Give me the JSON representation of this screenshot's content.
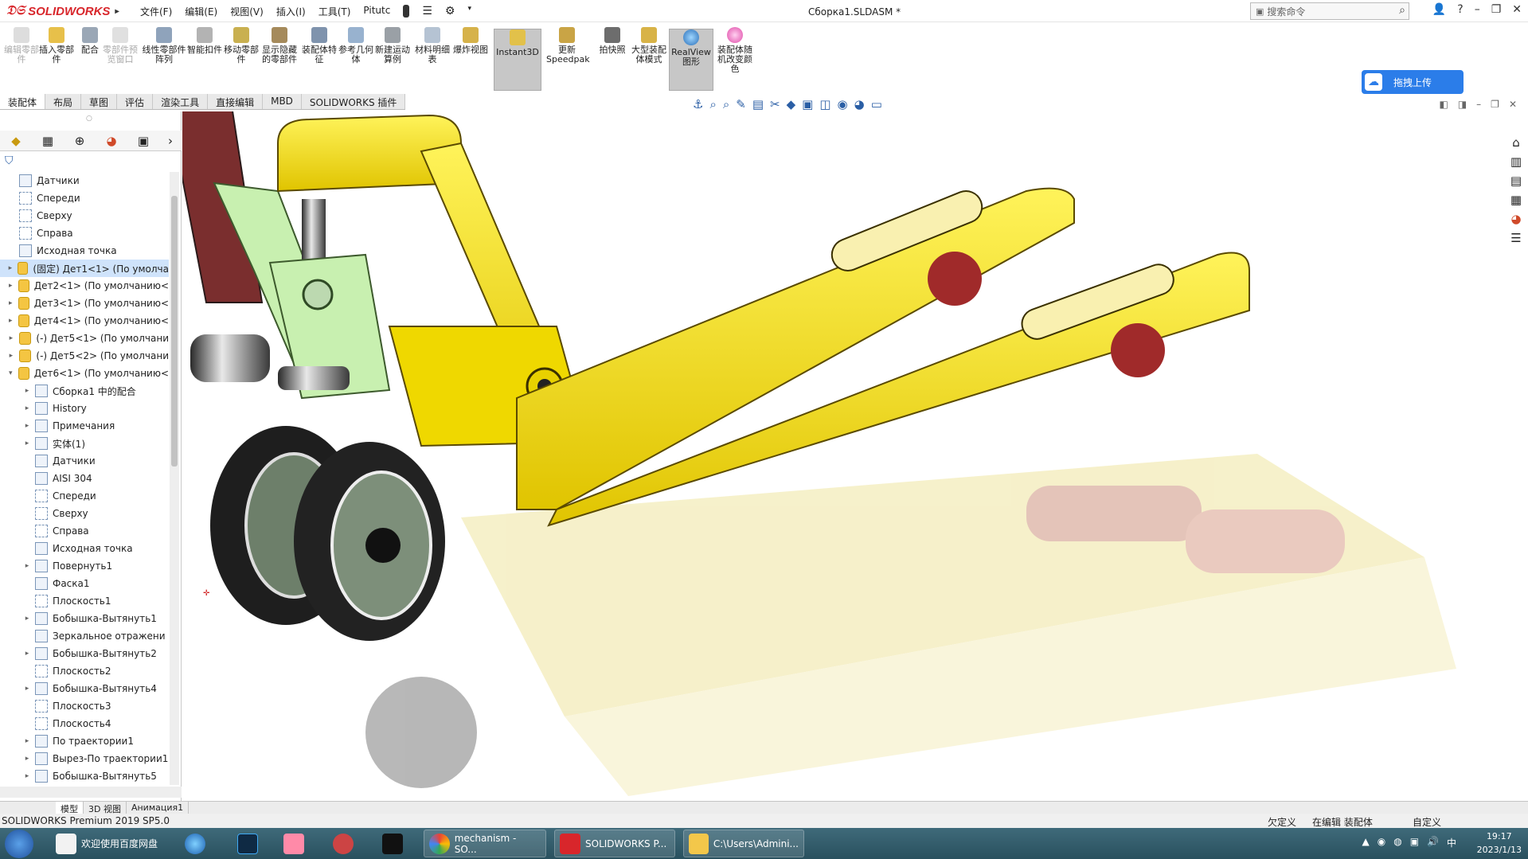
{
  "app": {
    "logo_text": "SOLIDWORKS",
    "document_title": "Сборка1.SLDASM *"
  },
  "menu": [
    "文件(F)",
    "编辑(E)",
    "视图(V)",
    "插入(I)",
    "工具(T)",
    "Pitutc"
  ],
  "search": {
    "placeholder": "搜索命令"
  },
  "commands": [
    {
      "label": "编辑零部件",
      "disabled": true
    },
    {
      "label": "插入零部件",
      "disabled": false
    },
    {
      "label": "配合",
      "disabled": false
    },
    {
      "label": "零部件预览窗口",
      "disabled": true
    },
    {
      "label": "线性零部件阵列",
      "disabled": false
    },
    {
      "label": "智能扣件",
      "disabled": false
    },
    {
      "label": "移动零部件",
      "disabled": false
    },
    {
      "label": "显示隐藏的零部件",
      "disabled": false
    },
    {
      "label": "装配体特征",
      "disabled": false
    },
    {
      "label": "参考几何体",
      "disabled": false
    },
    {
      "label": "新建运动算例",
      "disabled": false
    },
    {
      "label": "材料明细表",
      "disabled": false
    },
    {
      "label": "爆炸视图",
      "disabled": false
    },
    {
      "label": "Instant3D",
      "disabled": false,
      "active": true
    },
    {
      "label": "更新Speedpak",
      "disabled": false
    },
    {
      "label": "拍快照",
      "disabled": false
    },
    {
      "label": "大型装配体模式",
      "disabled": false
    },
    {
      "label": "RealView图形",
      "disabled": false,
      "active": true
    },
    {
      "label": "装配体随机改变颜色",
      "disabled": false
    }
  ],
  "upload_button": "拖拽上传",
  "tabs": [
    "装配体",
    "布局",
    "草图",
    "评估",
    "渲染工具",
    "直接编辑",
    "MBD",
    "SOLIDWORKS 插件"
  ],
  "tree": [
    {
      "label": "Датчики",
      "indent": 0,
      "expander": "",
      "icon": "sensor"
    },
    {
      "label": "Спереди",
      "indent": 0,
      "expander": "",
      "icon": "plane"
    },
    {
      "label": "Сверху",
      "indent": 0,
      "expander": "",
      "icon": "plane"
    },
    {
      "label": "Справа",
      "indent": 0,
      "expander": "",
      "icon": "plane"
    },
    {
      "label": "Исходная точка",
      "indent": 0,
      "expander": "",
      "icon": "origin"
    },
    {
      "label": "(固定) Дет1<1> (По умолча",
      "indent": 0,
      "expander": "▸",
      "icon": "part",
      "selected": true
    },
    {
      "label": "Дет2<1> (По умолчанию<",
      "indent": 0,
      "expander": "▸",
      "icon": "part"
    },
    {
      "label": "Дет3<1> (По умолчанию<",
      "indent": 0,
      "expander": "▸",
      "icon": "part"
    },
    {
      "label": "Дет4<1> (По умолчанию<",
      "indent": 0,
      "expander": "▸",
      "icon": "part"
    },
    {
      "label": "(-) Дет5<1> (По умолчани",
      "indent": 0,
      "expander": "▸",
      "icon": "part"
    },
    {
      "label": "(-) Дет5<2> (По умолчани",
      "indent": 0,
      "expander": "▸",
      "icon": "part"
    },
    {
      "label": "Дет6<1> (По умолчанию<",
      "indent": 0,
      "expander": "▾",
      "icon": "part"
    },
    {
      "label": "Сборка1 中的配合",
      "indent": 1,
      "expander": "▸",
      "icon": "mate"
    },
    {
      "label": "History",
      "indent": 1,
      "expander": "▸",
      "icon": "history"
    },
    {
      "label": "Примечания",
      "indent": 1,
      "expander": "▸",
      "icon": "annotation"
    },
    {
      "label": "实体(1)",
      "indent": 1,
      "expander": "▸",
      "icon": "solid"
    },
    {
      "label": "Датчики",
      "indent": 1,
      "expander": "",
      "icon": "sensor"
    },
    {
      "label": "AISI 304",
      "indent": 1,
      "expander": "",
      "icon": "material"
    },
    {
      "label": "Спереди",
      "indent": 1,
      "expander": "",
      "icon": "plane"
    },
    {
      "label": "Сверху",
      "indent": 1,
      "expander": "",
      "icon": "plane"
    },
    {
      "label": "Справа",
      "indent": 1,
      "expander": "",
      "icon": "plane"
    },
    {
      "label": "Исходная точка",
      "indent": 1,
      "expander": "",
      "icon": "origin"
    },
    {
      "label": "Повернуть1",
      "indent": 1,
      "expander": "▸",
      "icon": "feature"
    },
    {
      "label": "Фаска1",
      "indent": 1,
      "expander": "",
      "icon": "feature"
    },
    {
      "label": "Плоскость1",
      "indent": 1,
      "expander": "",
      "icon": "plane"
    },
    {
      "label": "Бобышка-Вытянуть1",
      "indent": 1,
      "expander": "▸",
      "icon": "feature"
    },
    {
      "label": "Зеркальное отражени",
      "indent": 1,
      "expander": "",
      "icon": "mirror"
    },
    {
      "label": "Бобышка-Вытянуть2",
      "indent": 1,
      "expander": "▸",
      "icon": "feature"
    },
    {
      "label": "Плоскость2",
      "indent": 1,
      "expander": "",
      "icon": "plane"
    },
    {
      "label": "Бобышка-Вытянуть4",
      "indent": 1,
      "expander": "▸",
      "icon": "feature"
    },
    {
      "label": "Плоскость3",
      "indent": 1,
      "expander": "",
      "icon": "plane"
    },
    {
      "label": "Плоскость4",
      "indent": 1,
      "expander": "",
      "icon": "plane"
    },
    {
      "label": "По траектории1",
      "indent": 1,
      "expander": "▸",
      "icon": "sweep"
    },
    {
      "label": "Вырез-По траектории1",
      "indent": 1,
      "expander": "▸",
      "icon": "feature"
    },
    {
      "label": "Бобышка-Вытянуть5",
      "indent": 1,
      "expander": "▸",
      "icon": "feature"
    }
  ],
  "model_tabs": [
    "模型",
    "3D 视图",
    "Анимация1"
  ],
  "status": {
    "product": "SOLIDWORKS Premium 2019 SP5.0",
    "defined": "欠定义",
    "editing": "在编辑 装配体",
    "custom": "自定义"
  },
  "taskbar": {
    "items": [
      {
        "label": "欢迎使用百度网盘",
        "button": false
      },
      {
        "label": "mechanism - SO...",
        "button": true
      },
      {
        "label": "SOLIDWORKS P...",
        "button": true
      },
      {
        "label": "C:\\Users\\Admini...",
        "button": true
      }
    ],
    "time": "19:17",
    "date": "2023/1/13"
  },
  "colors": {
    "accent": "#2b7de9",
    "selection": "#cfe3fb",
    "frame_yellow": "#f7e21a",
    "handle_green": "#c8f0b0",
    "handle_maroon": "#7a2e2e"
  }
}
